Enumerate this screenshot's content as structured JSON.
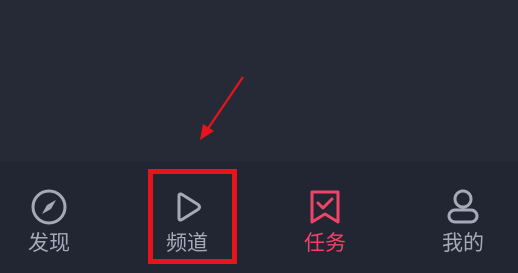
{
  "colors": {
    "background": "#262a37",
    "tabbar_background": "#222633",
    "inactive": "#a6aab8",
    "active": "#ef4468",
    "annotation": "#e8131b"
  },
  "tabs": [
    {
      "label": "发现",
      "icon": "compass-icon",
      "active": false
    },
    {
      "label": "频道",
      "icon": "play-icon",
      "active": false
    },
    {
      "label": "任务",
      "icon": "task-ribbon-check-icon",
      "active": true
    },
    {
      "label": "我的",
      "icon": "person-icon",
      "active": false
    }
  ]
}
